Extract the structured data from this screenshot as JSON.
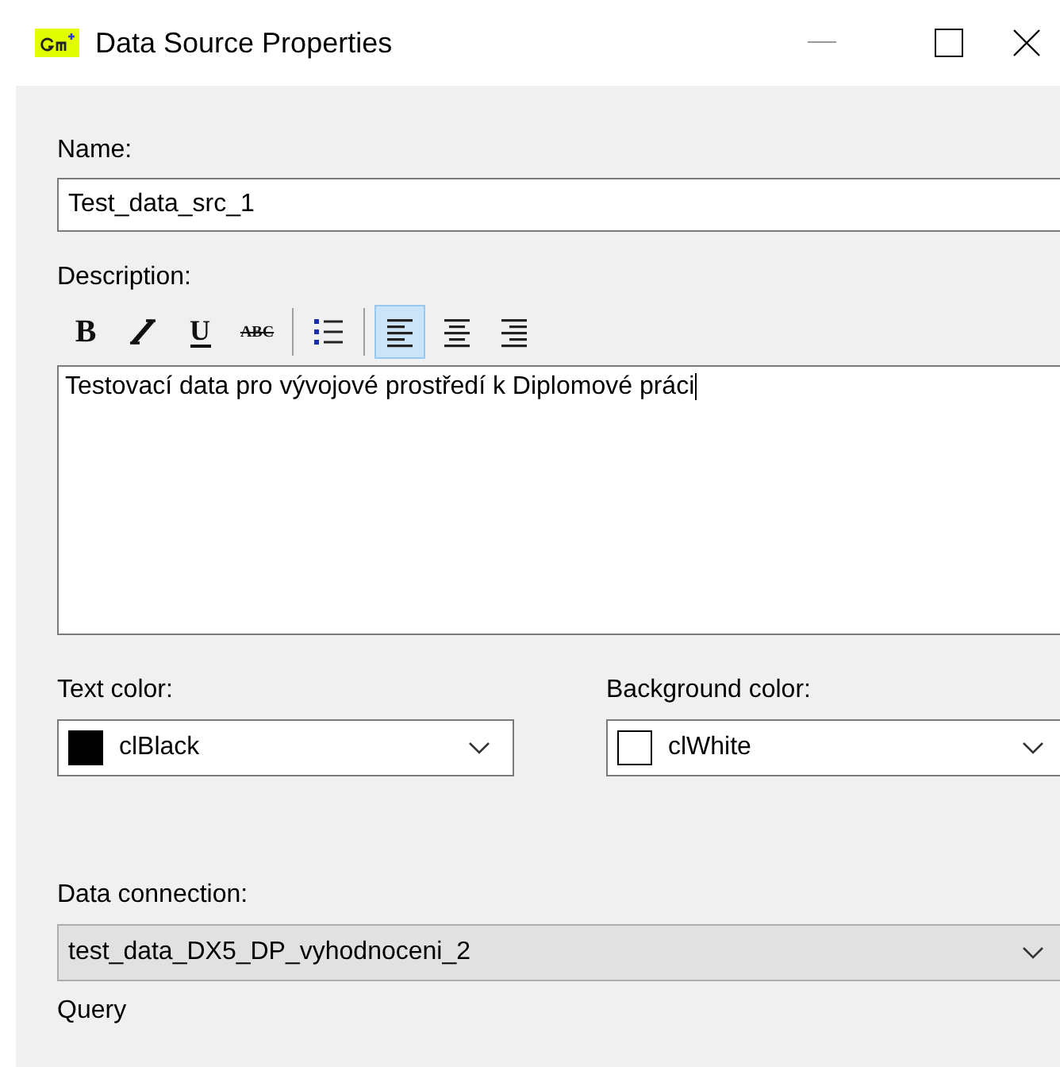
{
  "window": {
    "title": "Data Source Properties"
  },
  "name": {
    "label": "Name:",
    "value": "Test_data_src_1"
  },
  "description": {
    "label": "Description:",
    "toolbar": [
      {
        "kind": "bold",
        "text": "B",
        "selected": false
      },
      {
        "kind": "italic",
        "selected": false
      },
      {
        "kind": "underline",
        "text": "U",
        "selected": false
      },
      {
        "kind": "strikeout",
        "text": "ABC",
        "selected": false
      },
      {
        "kind": "separator"
      },
      {
        "kind": "bullets",
        "selected": false
      },
      {
        "kind": "separator"
      },
      {
        "kind": "align-left",
        "selected": true
      },
      {
        "kind": "align-center",
        "selected": false
      },
      {
        "kind": "align-right",
        "selected": false
      }
    ],
    "value": "Testovací data pro vývojové prostředí k Diplomové práci"
  },
  "text_color": {
    "label": "Text color:",
    "value": "clBlack",
    "color": "#000000"
  },
  "background_color": {
    "label": "Background color:",
    "value": "clWhite",
    "color": "#ffffff"
  },
  "data_connection": {
    "label": "Data connection:",
    "value": "test_data_DX5_DP_vyhodnoceni_2",
    "disabled": true
  },
  "query": {
    "label": "Query"
  }
}
